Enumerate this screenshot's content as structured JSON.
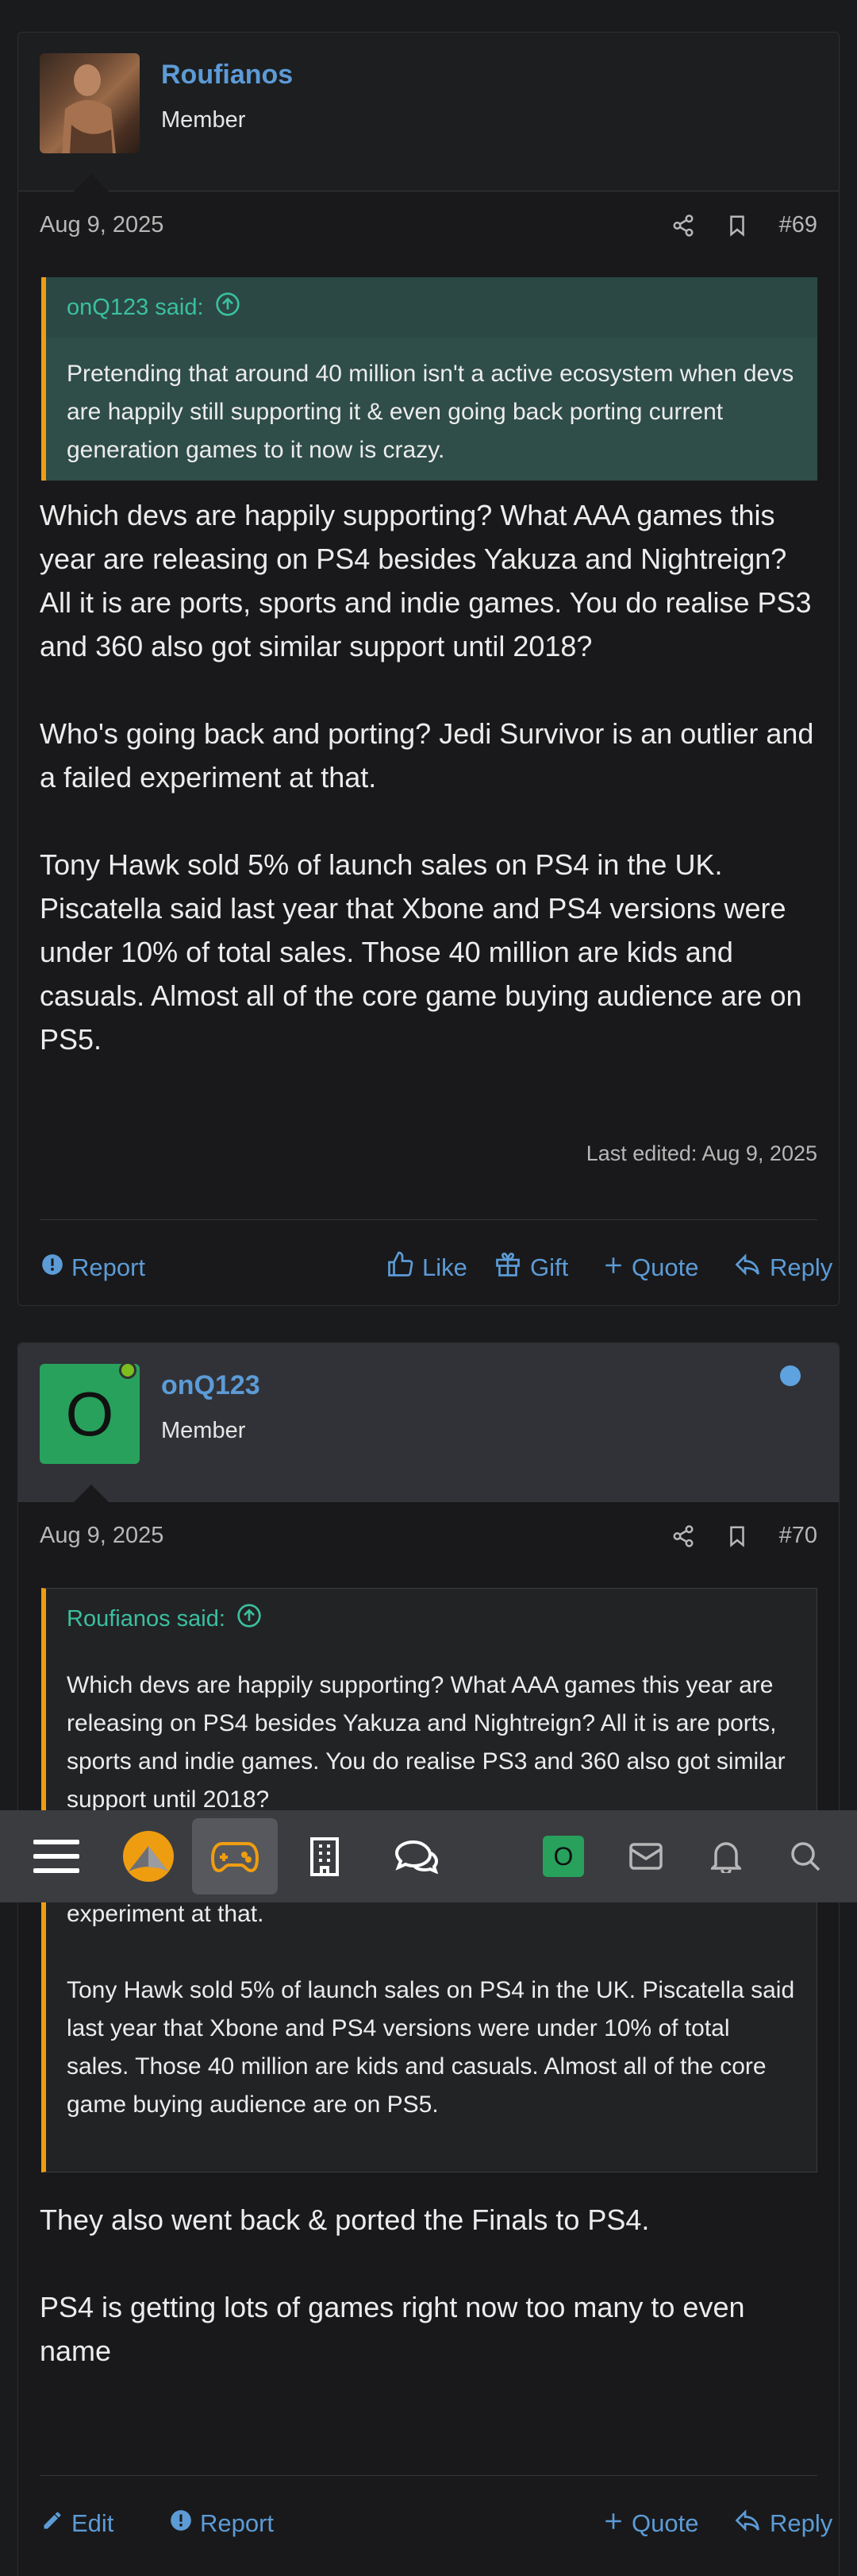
{
  "posts": [
    {
      "username": "Roufianos",
      "user_title": "Member",
      "date": "Aug 9, 2025",
      "post_number": "#69",
      "quote": {
        "author": "onQ123 said:",
        "paragraphs": [
          "Pretending that around 40 million isn't a active ecosystem when devs are happily still supporting it & even going back porting current generation games to it now is crazy."
        ]
      },
      "body": [
        "Which devs are happily supporting? What AAA games this year are releasing on PS4 besides Yakuza and Nightreign? All it is are ports, sports and indie games. You do realise PS3 and 360 also got similar support until 2018?",
        "Who's going back and porting? Jedi Survivor is an outlier and a failed experiment at that.",
        "Tony Hawk sold 5% of launch sales on PS4 in the UK. Piscatella said last year that Xbone and PS4 versions were under 10% of total sales. Those 40 million are kids and casuals. Almost all of the core game buying audience are on PS5."
      ],
      "last_edited": "Last edited: Aug 9, 2025",
      "actions": {
        "report": "Report",
        "like": "Like",
        "gift": "Gift",
        "quote": "Quote",
        "reply": "Reply"
      }
    },
    {
      "username": "onQ123",
      "avatar_letter": "O",
      "user_title": "Member",
      "date": "Aug 9, 2025",
      "post_number": "#70",
      "quote": {
        "author": "Roufianos said:",
        "paragraphs": [
          "Which devs are happily supporting? What AAA games this year are releasing on PS4 besides Yakuza and Nightreign? All it is are ports, sports and indie games. You do realise PS3 and 360 also got similar support until 2018?",
          "Who's going back and porting? Jedi Survivor is an outlier and a failed experiment at that.",
          "Tony Hawk sold 5% of launch sales on PS4 in the UK. Piscatella said last year that Xbone and PS4 versions were under 10% of total sales. Those 40 million are kids and casuals. Almost all of the core game buying audience are on PS5."
        ]
      },
      "body": [
        "They also went back & ported the Finals to PS4.",
        "PS4 is getting lots of games right now too many to even name"
      ],
      "actions": {
        "edit": "Edit",
        "report": "Report",
        "quote": "Quote",
        "reply": "Reply"
      }
    }
  ],
  "navbar": {
    "avatar_letter": "O",
    "icons": [
      "menu-icon",
      "site-logo-icon",
      "gamepad-icon",
      "building-icon",
      "chat-icon",
      "avatar",
      "mail-icon",
      "bell-icon",
      "search-icon"
    ],
    "active_color": "#ef9d10"
  },
  "colors": {
    "link": "#5c9bd6",
    "accent": "#ef9d10",
    "quote_author": "#3ac0a0"
  }
}
